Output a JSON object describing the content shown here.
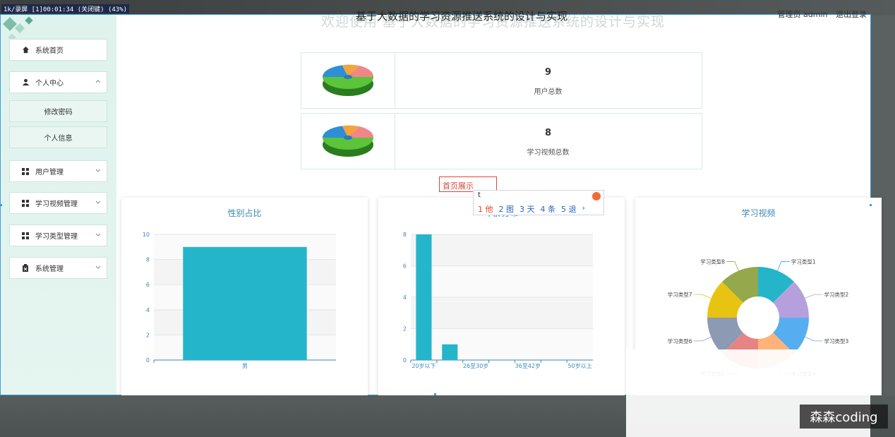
{
  "recorder": {
    "tag": "1k/录屏 [1]00:01:34 (关闭键) (43%)"
  },
  "header": {
    "title": "基于大数据的学习资源推送系统的设计与实现",
    "welcome_ghost": "欢迎使用 基于大数据的学习资源推送系统的设计与实现",
    "user_label": "管理员 admin",
    "logout": "退出登录"
  },
  "sidebar": {
    "items": [
      {
        "label": "系统首页",
        "icon": "home-icon"
      },
      {
        "label": "个人中心",
        "icon": "user-icon",
        "expanded": true
      },
      {
        "label": "修改密码"
      },
      {
        "label": "个人信息"
      },
      {
        "label": "用户管理",
        "icon": "grid-icon"
      },
      {
        "label": "学习视频管理",
        "icon": "grid-icon"
      },
      {
        "label": "学习类型管理",
        "icon": "grid-icon"
      },
      {
        "label": "系统管理",
        "icon": "trash-icon"
      }
    ]
  },
  "stats": [
    {
      "value": "9",
      "label": "用户总数"
    },
    {
      "value": "8",
      "label": "学习视频总数"
    }
  ],
  "search": {
    "value": "首页展示"
  },
  "ime": {
    "composition": "t",
    "candidates": [
      "1 他",
      "2 图",
      "3 天",
      "4 条",
      "5 退"
    ],
    "next": "›"
  },
  "cards": [
    {
      "title": "性别占比"
    },
    {
      "title": "年龄分布"
    },
    {
      "title": "学习视频"
    }
  ],
  "chart_data": [
    {
      "type": "bar",
      "title": "性别占比",
      "categories": [
        "男"
      ],
      "values": [
        9
      ],
      "ylim": [
        0,
        10
      ],
      "yticks": [
        0,
        2,
        4,
        6,
        8,
        10
      ],
      "color": "#25b5cb"
    },
    {
      "type": "bar",
      "title": "年龄分布",
      "categories": [
        "20岁以下",
        "",
        "26至30岁",
        "",
        "36至42岁",
        "",
        "50岁以上"
      ],
      "values": [
        8,
        1,
        0,
        0,
        0,
        0,
        0
      ],
      "ylim": [
        0,
        8
      ],
      "yticks": [
        0,
        2,
        4,
        6,
        8
      ],
      "color": "#25b5cb"
    },
    {
      "type": "pie",
      "title": "学习视频",
      "donut": true,
      "labels": [
        "学习类型1",
        "学习类型2",
        "学习类型3",
        "学习类型4",
        "学习类型5",
        "学习类型6",
        "学习类型7",
        "学习类型8"
      ],
      "values": [
        1,
        1,
        1,
        1,
        1,
        1,
        1,
        1
      ],
      "colors": [
        "#25b5cb",
        "#b5a0dd",
        "#56aef0",
        "#ffb37a",
        "#e88383",
        "#8c9ab4",
        "#e8c311",
        "#95a84b"
      ]
    }
  ],
  "watermark": "森森coding"
}
